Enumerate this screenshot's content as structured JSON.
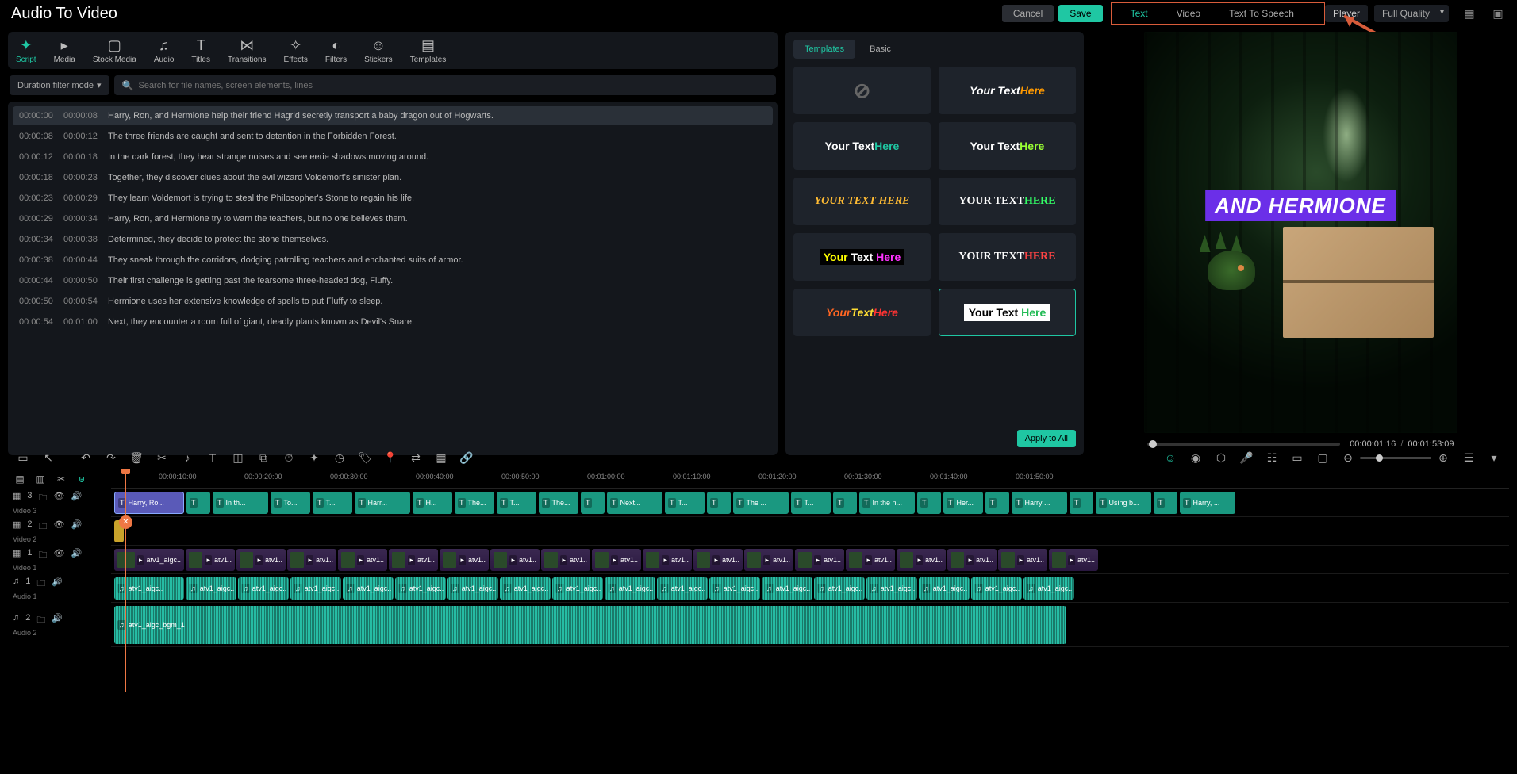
{
  "app_title": "Audio To Video",
  "buttons": {
    "cancel": "Cancel",
    "save": "Save",
    "apply_all": "Apply to All"
  },
  "prop_tabs": [
    "Text",
    "Video",
    "Text To Speech"
  ],
  "player": {
    "label": "Player",
    "quality": "Full Quality",
    "caption": "AND HERMIONE",
    "current": "00:00:01:16",
    "total": "00:01:53:09"
  },
  "tools": [
    "Script",
    "Media",
    "Stock Media",
    "Audio",
    "Titles",
    "Transitions",
    "Effects",
    "Filters",
    "Stickers",
    "Templates"
  ],
  "filter_mode": "Duration filter mode",
  "search_placeholder": "Search for file names, screen elements, lines",
  "mid_subtabs": [
    "Templates",
    "Basic"
  ],
  "templates_label": "Your Text Here",
  "script_lines": [
    {
      "t1": "00:00:00",
      "t2": "00:00:08",
      "txt": "Harry, Ron, and Hermione help their friend Hagrid secretly transport a baby dragon out of Hogwarts.",
      "sel": true
    },
    {
      "t1": "00:00:08",
      "t2": "00:00:12",
      "txt": "The three friends are caught and sent to detention in the Forbidden Forest."
    },
    {
      "t1": "00:00:12",
      "t2": "00:00:18",
      "txt": "In the dark forest, they hear strange noises and see eerie shadows moving around."
    },
    {
      "t1": "00:00:18",
      "t2": "00:00:23",
      "txt": "Together, they discover clues about the evil wizard Voldemort's sinister plan."
    },
    {
      "t1": "00:00:23",
      "t2": "00:00:29",
      "txt": "They learn Voldemort is trying to steal the Philosopher's Stone to regain his life."
    },
    {
      "t1": "00:00:29",
      "t2": "00:00:34",
      "txt": "Harry, Ron, and Hermione try to warn the teachers, but no one believes them."
    },
    {
      "t1": "00:00:34",
      "t2": "00:00:38",
      "txt": "Determined, they decide to protect the stone themselves."
    },
    {
      "t1": "00:00:38",
      "t2": "00:00:44",
      "txt": "They sneak through the corridors, dodging patrolling teachers and enchanted suits of armor."
    },
    {
      "t1": "00:00:44",
      "t2": "00:00:50",
      "txt": "Their first challenge is getting past the fearsome three-headed dog, Fluffy."
    },
    {
      "t1": "00:00:50",
      "t2": "00:00:54",
      "txt": "Hermione uses her extensive knowledge of spells to put Fluffy to sleep."
    },
    {
      "t1": "00:00:54",
      "t2": "00:01:00",
      "txt": "Next, they encounter a room full of giant, deadly plants known as Devil's Snare."
    }
  ],
  "ruler_marks": [
    "00:00:10:00",
    "00:00:20:00",
    "00:00:30:00",
    "00:00:40:00",
    "00:00:50:00",
    "00:01:00:00",
    "00:01:10:00",
    "00:01:20:00",
    "00:01:30:00",
    "00:01:40:00",
    "00:01:50:00"
  ],
  "tracks": {
    "v3": "Video 3",
    "v2": "Video 2",
    "v1": "Video 1",
    "a1": "Audio 1",
    "a2": "Audio 2"
  },
  "text_clips": [
    "Harry, Ro...",
    "",
    "In th...",
    "To...",
    "T...",
    "Harr...",
    "H...",
    "The...",
    "T...",
    "The...",
    "",
    "Next...",
    "T...",
    "",
    "The ...",
    "T...",
    "",
    "In the n...",
    "",
    "Her...",
    "",
    "Harry ...",
    "",
    "Using b...",
    "",
    "Harry, ..."
  ],
  "video_clip_prefix": "atv1",
  "audio_clip_prefix": "atv1_aigc",
  "bgm_clip": "atv1_aigc_bgm_1"
}
